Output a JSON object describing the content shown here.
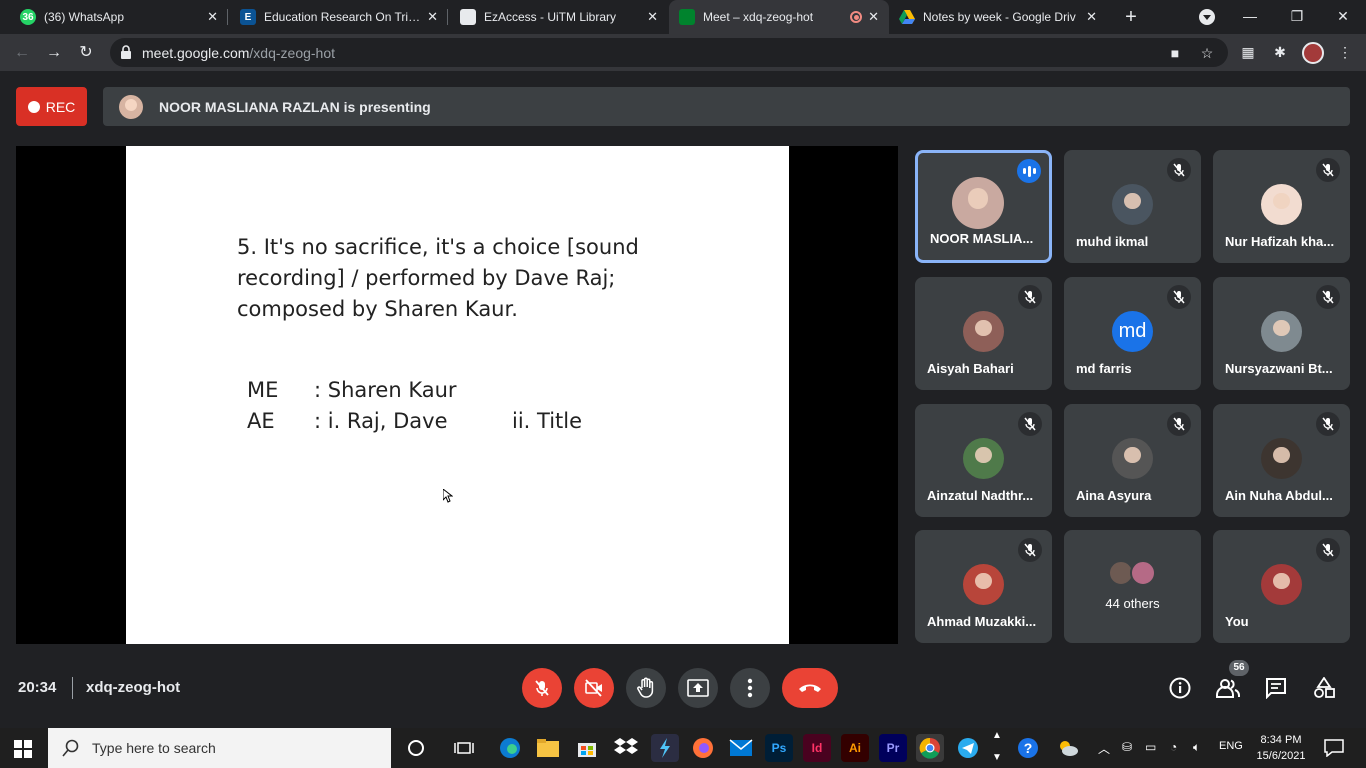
{
  "browser": {
    "tabs": [
      {
        "title": "(36) WhatsApp",
        "favicon_text": "36",
        "favicon_color": "#25d366"
      },
      {
        "title": "Education Research On Trial :",
        "favicon_text": "E",
        "favicon_color": "#0b5394"
      },
      {
        "title": "EzAccess - UiTM Library",
        "favicon_text": "",
        "favicon_color": "#e8eaed"
      },
      {
        "title": "Meet – xdq-zeog-hot",
        "favicon_text": "",
        "favicon_color": "#00832d",
        "active": true
      },
      {
        "title": "Notes by week - Google Driv",
        "favicon_text": "",
        "favicon_color": "#fbbc04"
      }
    ],
    "url_host": "meet.google.com",
    "url_path": "/xdq-zeog-hot"
  },
  "meeting": {
    "rec_label": "REC",
    "presenting_text": "NOOR MASLIANA RAZLAN is presenting",
    "clock": "20:34",
    "code": "xdq-zeog-hot",
    "participant_count": "56"
  },
  "slide": {
    "line1": "5. It's no sacrifice, it's a choice [sound",
    "line2": "recording] / performed by Dave Raj;",
    "line3": "composed by Sharen Kaur.",
    "me_label": "ME",
    "me_value": ": Sharen Kaur",
    "ae_label": "AE",
    "ae_value": ": i. Raj, Dave",
    "ae_value2": "ii. Title"
  },
  "participants": [
    {
      "name": "NOOR MASLIA...",
      "speaking": true,
      "avatar_color": "#c9a9a0"
    },
    {
      "name": "muhd ikmal",
      "muted": true,
      "avatar_color": "#4a5560"
    },
    {
      "name": "Nur Hafizah kha...",
      "muted": true,
      "avatar_color": "#f2dcd0"
    },
    {
      "name": "Aisyah Bahari",
      "muted": true,
      "avatar_color": "#8e5f58"
    },
    {
      "name": "md farris",
      "muted": true,
      "avatar_color": "#1a73e8",
      "initials": "md"
    },
    {
      "name": "Nursyazwani Bt...",
      "muted": true,
      "avatar_color": "#7f8a90"
    },
    {
      "name": "Ainzatul Nadthr...",
      "muted": true,
      "avatar_color": "#4f7a4a"
    },
    {
      "name": "Aina Asyura",
      "muted": true,
      "avatar_color": "#555"
    },
    {
      "name": "Ain Nuha Abdul...",
      "muted": true,
      "avatar_color": "#3d3530"
    },
    {
      "name": "Ahmad Muzakki...",
      "muted": true,
      "avatar_color": "#b8453a"
    },
    {
      "name": "44 others",
      "others": true
    },
    {
      "name": "You",
      "muted": true,
      "avatar_color": "#a33a3a"
    }
  ],
  "taskbar": {
    "search_placeholder": "Type here to search",
    "time": "8:34 PM",
    "date": "15/6/2021",
    "lang": "ENG"
  }
}
